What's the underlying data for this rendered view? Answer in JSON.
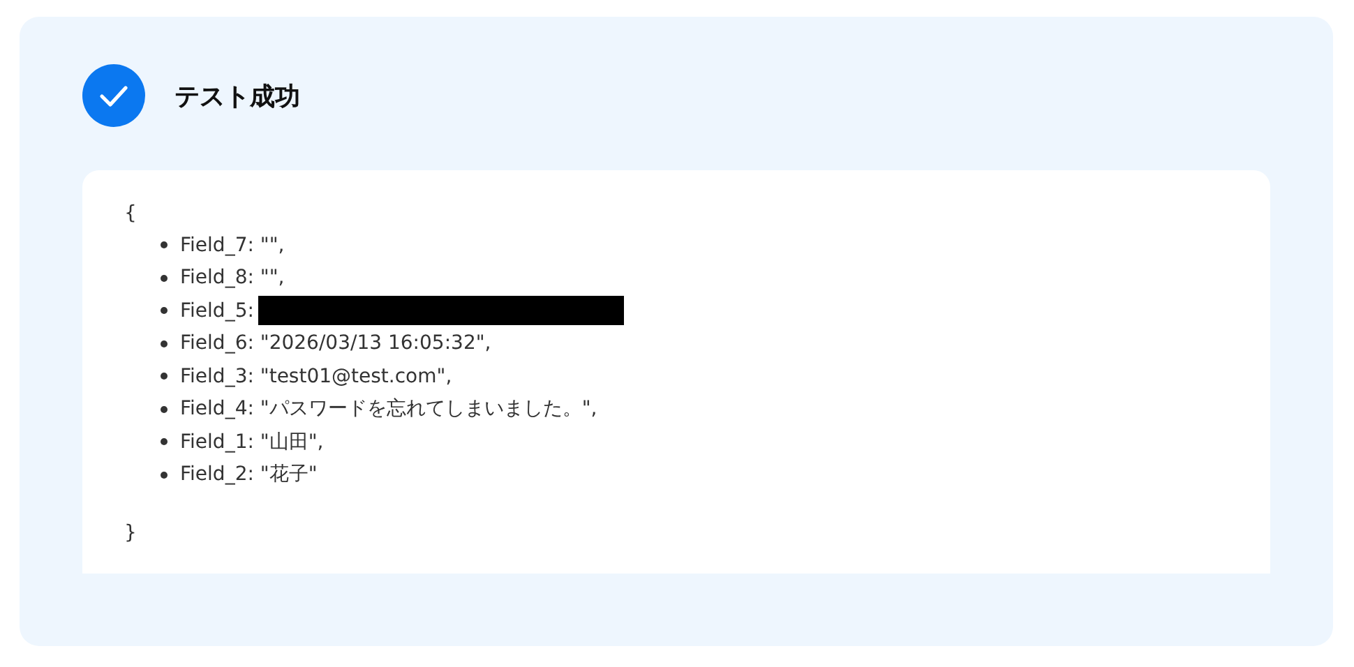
{
  "result": {
    "passed": true,
    "title": "テスト成功"
  },
  "output": {
    "open": "{",
    "close": "}",
    "fields": [
      {
        "kind": "text",
        "label": "Field_7: \"\","
      },
      {
        "kind": "text",
        "label": "Field_8: \"\","
      },
      {
        "kind": "redacted",
        "label": "Field_5:"
      },
      {
        "kind": "text",
        "label": "Field_6: \"2026/03/13 16:05:32\","
      },
      {
        "kind": "text",
        "label": "Field_3: \"test01@test.com\","
      },
      {
        "kind": "text",
        "label": "Field_4: \"パスワードを忘れてしまいました。\","
      },
      {
        "kind": "text",
        "label": "Field_1: \"山田\","
      },
      {
        "kind": "text",
        "label": "Field_2: \"花子\""
      }
    ]
  }
}
